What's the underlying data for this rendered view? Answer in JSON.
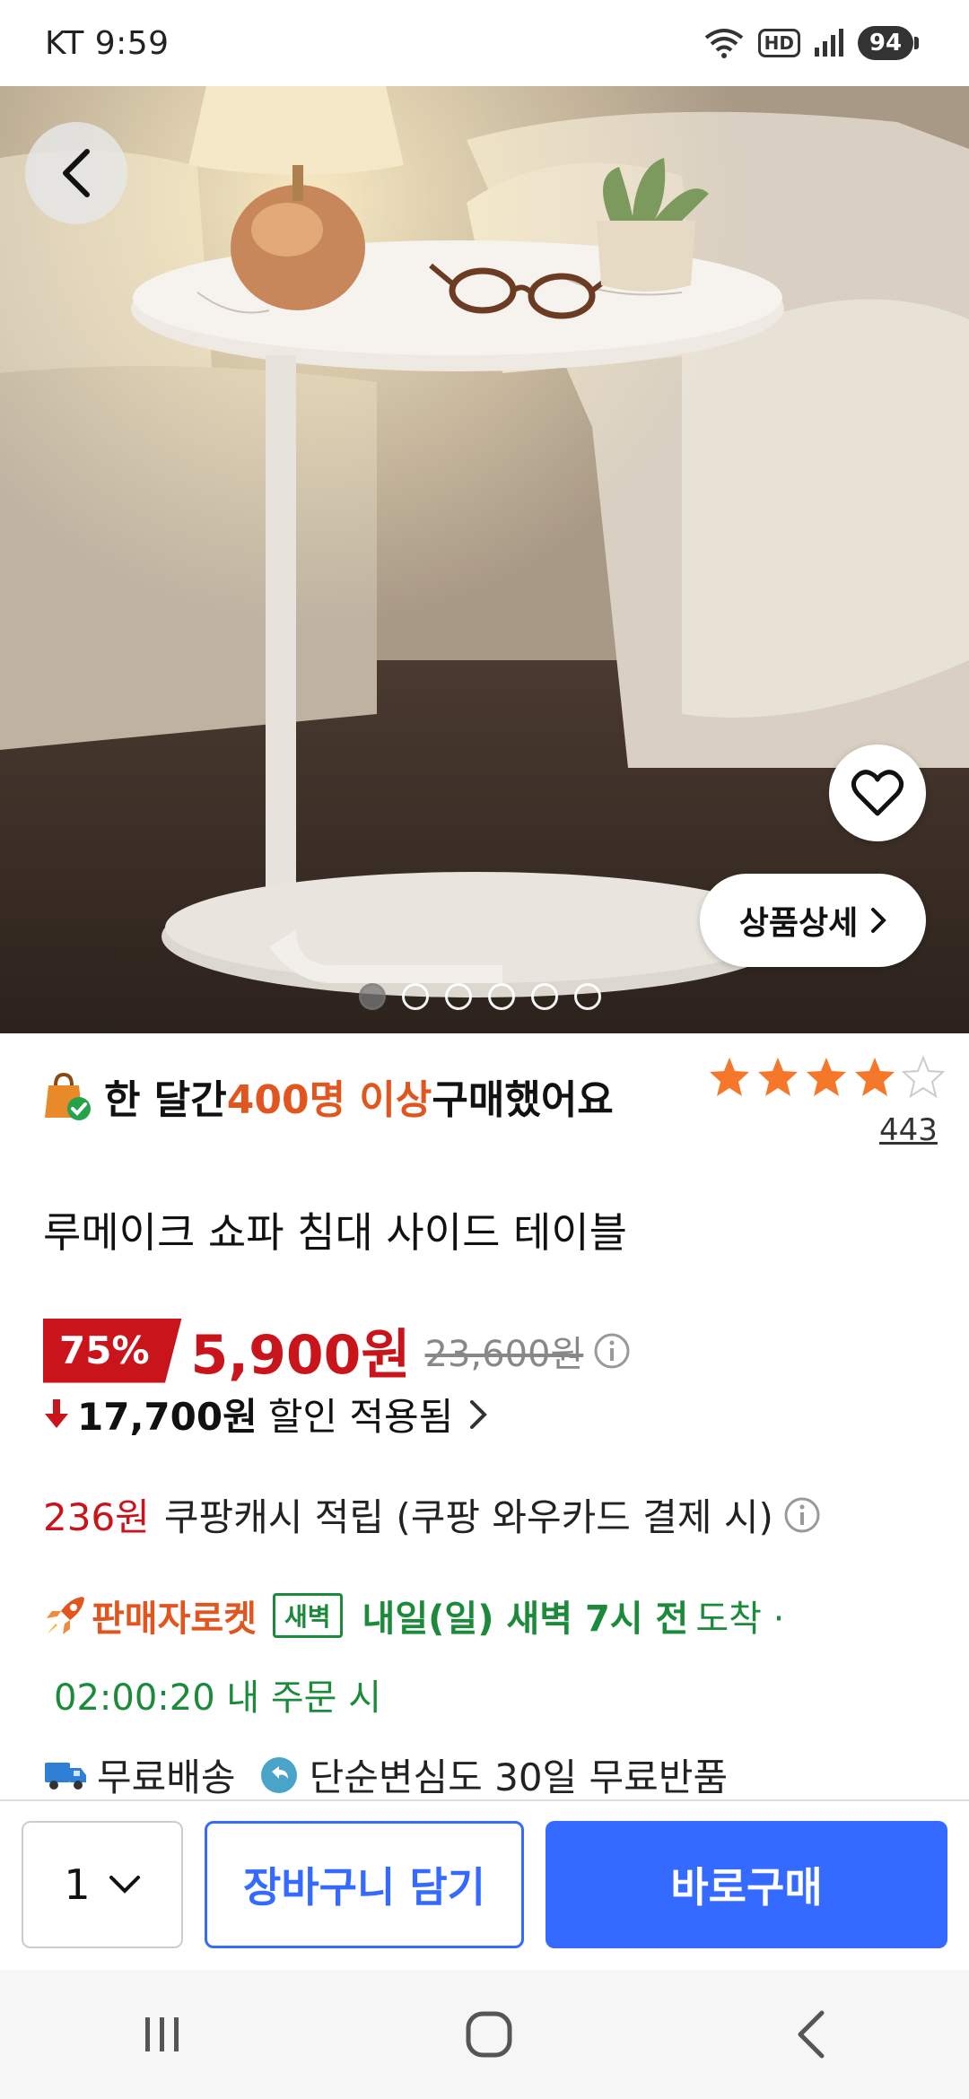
{
  "status_bar": {
    "carrier_time": "KT 9:59",
    "hd": "HD",
    "battery": "94"
  },
  "hero": {
    "back_icon": "chevron-left-icon",
    "wishlist_icon": "heart-outline-icon",
    "detail_label": "상품상세",
    "total_images": 6,
    "active_image": 1
  },
  "popularity": {
    "prefix": "한 달간 ",
    "highlight": "400명 이상",
    "suffix": " 구매했어요"
  },
  "rating": {
    "stars": 4,
    "max": 5,
    "count": "443"
  },
  "product": {
    "title": "루메이크 쇼파 침대 사이드 테이블"
  },
  "price": {
    "discount": "75%",
    "sale": "5,900원",
    "original": "23,600원",
    "saved_amount": "17,700원",
    "saved_text": "할인 적용됨"
  },
  "cash": {
    "amount": "236원",
    "text": "쿠팡캐시 적립 (쿠팡 와우카드 결제 시)"
  },
  "delivery": {
    "seller_rocket": "판매자로켓",
    "dawn_badge": "새벽",
    "arrive": "내일(일) 새벽 7시 전",
    "arrive_suffix": "도착 ·",
    "countdown": "02:00:20 내 주문 시"
  },
  "shipping": {
    "free_shipping": "무료배송",
    "free_return": "단순변심도 30일 무료반품"
  },
  "bottom_bar": {
    "quantity": "1",
    "cart_label": "장바구니 담기",
    "buy_label": "바로구매"
  },
  "colors": {
    "accent_blue": "#346aff",
    "sale_red": "#c9141c",
    "highlight_orange": "#e0561e",
    "rocket_green": "#1b8a3a",
    "star_orange": "#f5772a"
  }
}
